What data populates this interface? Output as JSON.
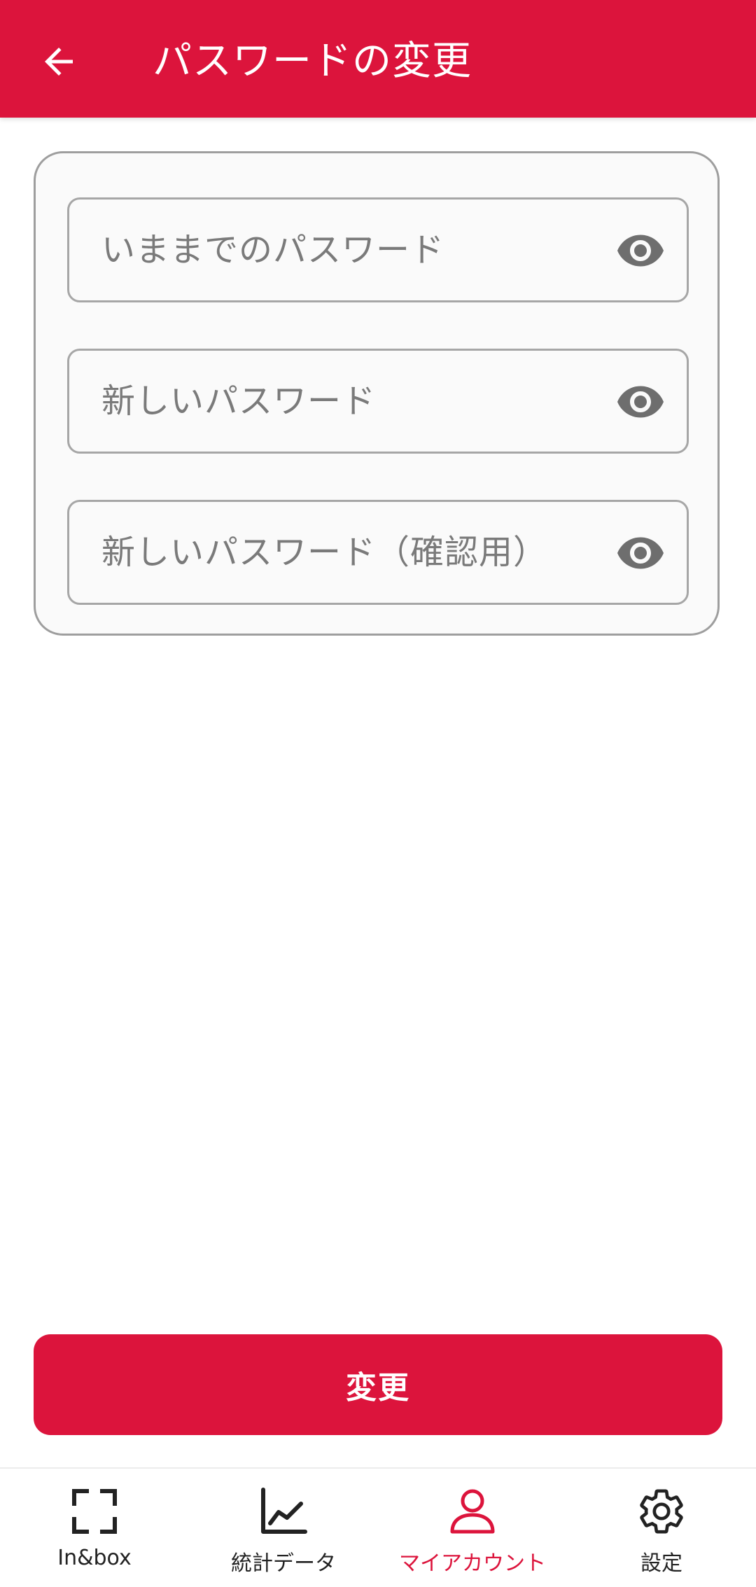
{
  "colors": {
    "accent": "#DC143C",
    "field_border": "#a6a6a6",
    "placeholder": "#7a7a7a",
    "icon_gray": "#6e6e6e"
  },
  "app_bar": {
    "back_icon": "arrow-back-icon",
    "title": "パスワードの変更"
  },
  "form": {
    "fields": [
      {
        "placeholder": "いままでのパスワード",
        "icon": "eye-icon"
      },
      {
        "placeholder": "新しいパスワード",
        "icon": "eye-icon"
      },
      {
        "placeholder": "新しいパスワード（確認用）",
        "icon": "eye-icon"
      }
    ],
    "submit_label": "変更"
  },
  "bottom_nav": {
    "items": [
      {
        "label": "In&box",
        "icon": "scan-frame-icon",
        "active": false
      },
      {
        "label": "統計データ",
        "icon": "line-chart-icon",
        "active": false
      },
      {
        "label": "マイアカウント",
        "icon": "person-icon",
        "active": true
      },
      {
        "label": "設定",
        "icon": "gear-icon",
        "active": false
      }
    ]
  }
}
